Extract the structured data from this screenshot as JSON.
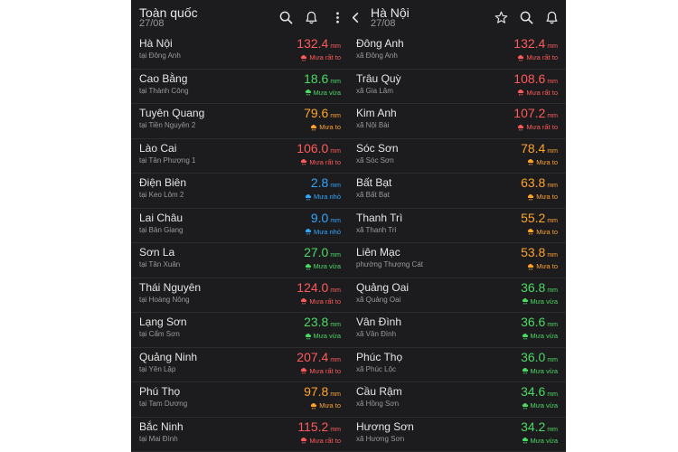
{
  "colors": {
    "red": "#ff5a5a",
    "green": "#4cd964",
    "orange": "#ffa32b",
    "blue": "#2fa7ff"
  },
  "left": {
    "title": "Toàn quốc",
    "date": "27/08",
    "icons": [
      "search-icon",
      "bell-icon",
      "more-vertical-icon"
    ],
    "rows": [
      {
        "name": "Hà Nội",
        "loc": "tại Đông Anh",
        "value": "132.4",
        "unit": "mm",
        "label": "Mưa rất to",
        "color": "red"
      },
      {
        "name": "Cao Bằng",
        "loc": "tại Thành Công",
        "value": "18.6",
        "unit": "mm",
        "label": "Mưa vừa",
        "color": "green"
      },
      {
        "name": "Tuyên Quang",
        "loc": "tại Tiền Nguyên 2",
        "value": "79.6",
        "unit": "mm",
        "label": "Mưa to",
        "color": "orange"
      },
      {
        "name": "Lào Cai",
        "loc": "tại Tân Phượng 1",
        "value": "106.0",
        "unit": "mm",
        "label": "Mưa rất to",
        "color": "red"
      },
      {
        "name": "Điện Biên",
        "loc": "tại Keo Lôm 2",
        "value": "2.8",
        "unit": "mm",
        "label": "Mưa nhỏ",
        "color": "blue"
      },
      {
        "name": "Lai Châu",
        "loc": "tại Bản Giang",
        "value": "9.0",
        "unit": "mm",
        "label": "Mưa nhỏ",
        "color": "blue"
      },
      {
        "name": "Sơn La",
        "loc": "tại Tân Xuân",
        "value": "27.0",
        "unit": "mm",
        "label": "Mưa vừa",
        "color": "green"
      },
      {
        "name": "Thái Nguyên",
        "loc": "tại Hoàng Nông",
        "value": "124.0",
        "unit": "mm",
        "label": "Mưa rất to",
        "color": "red"
      },
      {
        "name": "Lạng Sơn",
        "loc": "tại Cẩm Sơn",
        "value": "23.8",
        "unit": "mm",
        "label": "Mưa vừa",
        "color": "green"
      },
      {
        "name": "Quảng Ninh",
        "loc": "tại Yên Lập",
        "value": "207.4",
        "unit": "mm",
        "label": "Mưa rất to",
        "color": "red"
      },
      {
        "name": "Phú Thọ",
        "loc": "tại Tam Dương",
        "value": "97.8",
        "unit": "mm",
        "label": "Mưa to",
        "color": "orange"
      },
      {
        "name": "Bắc Ninh",
        "loc": "tại Mai Đình",
        "value": "115.2",
        "unit": "mm",
        "label": "Mưa rất to",
        "color": "red"
      }
    ]
  },
  "right": {
    "title": "Hà Nội",
    "date": "27/08",
    "icons": [
      "back-chevron-icon",
      "star-icon",
      "search-icon",
      "bell-icon"
    ],
    "rows": [
      {
        "name": "Đông Anh",
        "loc": "xã Đông Anh",
        "value": "132.4",
        "unit": "mm",
        "label": "Mưa rất to",
        "color": "red"
      },
      {
        "name": "Trâu Quỳ",
        "loc": "xã Gia Lâm",
        "value": "108.6",
        "unit": "mm",
        "label": "Mưa rất to",
        "color": "red"
      },
      {
        "name": "Kim Anh",
        "loc": "xã Nội Bài",
        "value": "107.2",
        "unit": "mm",
        "label": "Mưa rất to",
        "color": "red"
      },
      {
        "name": "Sóc Sơn",
        "loc": "xã Sóc Sơn",
        "value": "78.4",
        "unit": "mm",
        "label": "Mưa to",
        "color": "orange"
      },
      {
        "name": "Bất Bạt",
        "loc": "xã Bất Bạt",
        "value": "63.8",
        "unit": "mm",
        "label": "Mưa to",
        "color": "orange"
      },
      {
        "name": "Thanh Trì",
        "loc": "xã Thanh Trì",
        "value": "55.2",
        "unit": "mm",
        "label": "Mưa to",
        "color": "orange"
      },
      {
        "name": "Liên Mạc",
        "loc": "phường Thượng Cát",
        "value": "53.8",
        "unit": "mm",
        "label": "Mưa to",
        "color": "orange"
      },
      {
        "name": "Quảng Oai",
        "loc": "xã Quảng Oai",
        "value": "36.8",
        "unit": "mm",
        "label": "Mưa vừa",
        "color": "green"
      },
      {
        "name": "Vân Đình",
        "loc": "xã Vân Đình",
        "value": "36.6",
        "unit": "mm",
        "label": "Mưa vừa",
        "color": "green"
      },
      {
        "name": "Phúc Thọ",
        "loc": "xã Phúc Lộc",
        "value": "36.0",
        "unit": "mm",
        "label": "Mưa vừa",
        "color": "green"
      },
      {
        "name": "Cầu Rậm",
        "loc": "xã Hồng Sơn",
        "value": "34.6",
        "unit": "mm",
        "label": "Mưa vừa",
        "color": "green"
      },
      {
        "name": "Hương Sơn",
        "loc": "xã Hương Sơn",
        "value": "34.2",
        "unit": "mm",
        "label": "Mưa vừa",
        "color": "green"
      }
    ]
  }
}
